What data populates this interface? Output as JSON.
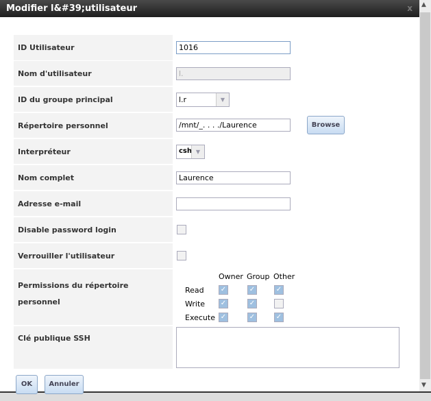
{
  "dialog": {
    "title": "Modifier l&#39;utilisateur",
    "close": "x"
  },
  "fields": {
    "uid": {
      "label": "ID Utilisateur",
      "value": "1016"
    },
    "username": {
      "label": "Nom d'utilisateur",
      "value": "l."
    },
    "group": {
      "label": "ID du groupe principal",
      "value": "l.r"
    },
    "home": {
      "label": "Répertoire personnel",
      "value": "/mnt/_. . . ./Laurence",
      "browse": "Browse"
    },
    "shell": {
      "label": "Interpréteur",
      "value": "csh"
    },
    "fullname": {
      "label": "Nom complet",
      "value": "Laurence"
    },
    "email": {
      "label": "Adresse e-mail",
      "value": ""
    },
    "disable_pw": {
      "label": "Disable password login",
      "checked": false
    },
    "lock": {
      "label": "Verrouiller l'utilisateur",
      "checked": false
    },
    "perms": {
      "label": "Permissions du répertoire personnel",
      "columns": [
        "Owner",
        "Group",
        "Other"
      ],
      "rows": [
        {
          "name": "Read",
          "values": [
            true,
            true,
            true
          ]
        },
        {
          "name": "Write",
          "values": [
            true,
            true,
            false
          ]
        },
        {
          "name": "Execute",
          "values": [
            true,
            true,
            true
          ]
        }
      ]
    },
    "ssh": {
      "label": "Clé publique SSH",
      "value": ""
    }
  },
  "buttons": {
    "ok": "OK",
    "cancel": "Annuler"
  }
}
